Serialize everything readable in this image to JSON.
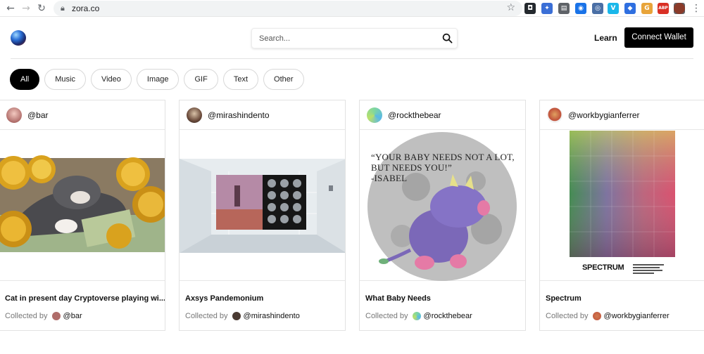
{
  "browser": {
    "url": "zora.co",
    "extensions": [
      {
        "name": "extension-1-icon",
        "color": "#24292e",
        "glyph": "◘"
      },
      {
        "name": "extension-2-icon",
        "color": "#3b6fd6",
        "glyph": "✦"
      },
      {
        "name": "extension-3-icon",
        "color": "#5f6368",
        "glyph": "▤"
      },
      {
        "name": "extension-4-icon",
        "color": "#1a73e8",
        "glyph": "◉"
      },
      {
        "name": "extension-5-icon",
        "color": "#4a6fa5",
        "glyph": "◎"
      },
      {
        "name": "vimeo-icon",
        "color": "#1ab7ea",
        "glyph": "V"
      },
      {
        "name": "extension-7-icon",
        "color": "#2f6fe0",
        "glyph": "◆"
      },
      {
        "name": "extension-8-icon",
        "color": "#e8a43a",
        "glyph": "G"
      },
      {
        "name": "adblock-icon",
        "color": "#d93025",
        "glyph": "ABP"
      },
      {
        "name": "puzzle-icon",
        "color": "#5f6368",
        "glyph": "✚"
      },
      {
        "name": "profile-avatar-icon",
        "color": "#8a3b2a",
        "glyph": ""
      }
    ]
  },
  "header": {
    "search_placeholder": "Search...",
    "learn_label": "Learn",
    "connect_label": "Connect Wallet"
  },
  "filters": [
    "All",
    "Music",
    "Video",
    "Image",
    "GIF",
    "Text",
    "Other"
  ],
  "cards": [
    {
      "handle": "@bar",
      "title": "Cat in present day Cryptoverse playing wi...",
      "collected_label": "Collected by",
      "collector": "@bar"
    },
    {
      "handle": "@mirashindento",
      "title": "Axsys Pandemonium",
      "collected_label": "Collected by",
      "collector": "@mirashindento"
    },
    {
      "handle": "@rockthebear",
      "title": "What Baby Needs",
      "collected_label": "Collected by",
      "collector": "@rockthebear",
      "art_text": [
        "“YOUR BABY NEEDS NOT A LOT,",
        "BUT NEEDS YOU!”",
        "-ISABEL"
      ]
    },
    {
      "handle": "@workbygianferrer",
      "title": "Spectrum",
      "collected_label": "Collected by",
      "collector": "@workbygianferrer",
      "art_text": [
        "SPECTRUM"
      ]
    }
  ],
  "colors": {
    "accent": "#000000",
    "border": "#e2e2e2"
  }
}
